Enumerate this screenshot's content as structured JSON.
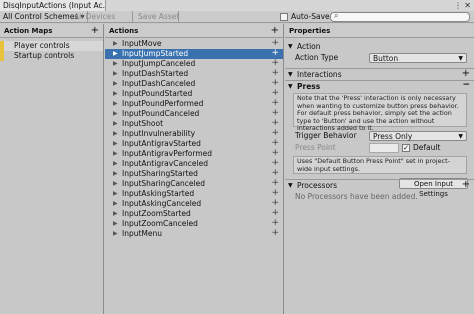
{
  "window": {
    "tab_title": "DisqInputActions (Input Ac...",
    "menu_icon": "kebab-menu-icon",
    "close_icon": "close-icon"
  },
  "toolbar": {
    "control_schemes": "All Control Schemes ▾",
    "devices": "All Devices",
    "save_asset": "Save Asset",
    "auto_save_label": "Auto-Save",
    "auto_save_checked": false,
    "search_placeholder": ""
  },
  "action_maps": {
    "header": "Action Maps",
    "items": [
      "Player controls",
      "Startup controls"
    ],
    "accent_color": "#e8c23a"
  },
  "actions": {
    "header": "Actions",
    "selected_index": 1,
    "items": [
      "InputMove",
      "InputJumpStarted",
      "InputJumpCanceled",
      "InputDashStarted",
      "InputDashCanceled",
      "InputPoundStarted",
      "InputPoundPerformed",
      "InputPoundCanceled",
      "InputShoot",
      "InputInvulnerability",
      "InputAntigravStarted",
      "InputAntigravPerformed",
      "InputAntigravCanceled",
      "InputSharingStarted",
      "InputSharingCanceled",
      "InputAskingStarted",
      "InputAskingCanceled",
      "InputZoomStarted",
      "InputZoomCanceled",
      "InputMenu"
    ],
    "selected_color": "#3a72b0"
  },
  "properties": {
    "header": "Properties",
    "action_section": "Action",
    "action_type_label": "Action Type",
    "action_type_value": "Button",
    "interactions_section": "Interactions",
    "press_section": "Press",
    "press_note": "Note that the 'Press' interaction is only necessary when wanting to customize button press behavior. For default press behavior, simply set the action type to 'Button' and use the action without interactions added to it.",
    "trigger_behavior_label": "Trigger Behavior",
    "trigger_behavior_value": "Press Only",
    "press_point_label": "Press Point",
    "press_point_value": "0.5",
    "default_label": "Default",
    "default_checked": true,
    "press_point_note": "Uses \"Default Button Press Point\" set in project-wide input settings.",
    "open_settings_button": "Open Input Settings",
    "processors_section": "Processors",
    "no_processors": "No Processors have been added."
  }
}
